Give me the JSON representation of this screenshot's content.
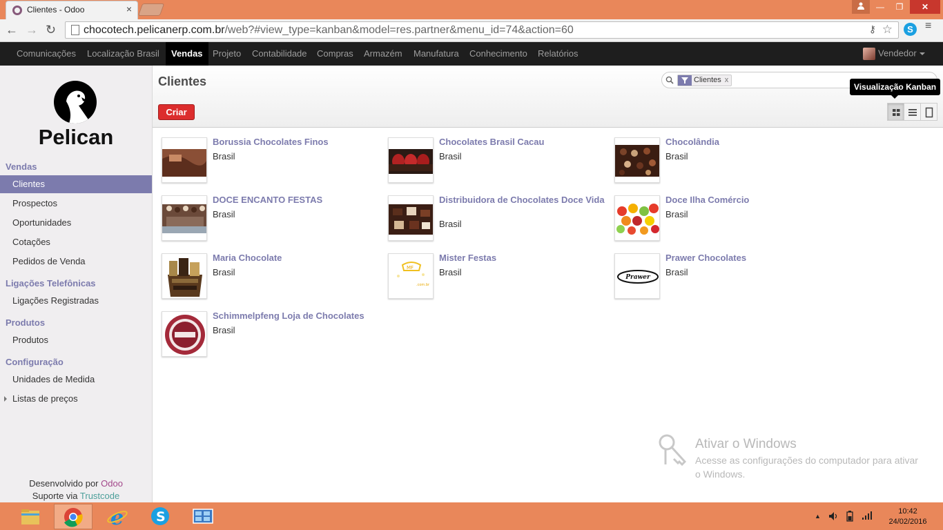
{
  "browser": {
    "tab_title": "Clientes - Odoo",
    "tab_close": "×",
    "url_host": "chocotech.pelicanerp.com.br",
    "url_path": "/web?#view_type=kanban&model=res.partner&menu_id=74&action=60",
    "back": "←",
    "forward": "→",
    "reload": "↻",
    "star": "☆",
    "key_icon": "⚷",
    "skype_letter": "S",
    "menu": "≡",
    "win_min": "—",
    "win_max": "❐",
    "win_close": "✕"
  },
  "topmenu": {
    "items": [
      {
        "label": "Comunicações"
      },
      {
        "label": "Localização Brasil"
      },
      {
        "label": "Vendas"
      },
      {
        "label": "Projeto"
      },
      {
        "label": "Contabilidade"
      },
      {
        "label": "Compras"
      },
      {
        "label": "Armazém"
      },
      {
        "label": "Manufatura"
      },
      {
        "label": "Conhecimento"
      },
      {
        "label": "Relatórios"
      }
    ],
    "active": "Vendas",
    "user": "Vendedor"
  },
  "sidebar": {
    "logo_text": "Pelican",
    "sections": [
      {
        "title": "Vendas",
        "items": [
          "Clientes",
          "Prospectos",
          "Oportunidades",
          "Cotações",
          "Pedidos de Venda"
        ]
      },
      {
        "title": "Ligações Telefônicas",
        "items": [
          "Ligações Registradas"
        ]
      },
      {
        "title": "Produtos",
        "items": [
          "Produtos"
        ]
      },
      {
        "title": "Configuração",
        "items": [
          "Unidades de Medida",
          "Listas de preços"
        ]
      }
    ],
    "active_item": "Clientes",
    "footer": {
      "dev_prefix": "Desenvolvido por ",
      "dev_brand": "Odoo",
      "support_prefix": "Suporte via ",
      "support_brand": "Trustcode"
    }
  },
  "controlpanel": {
    "title": "Clientes",
    "create_button": "Criar",
    "search_facet": "Clientes",
    "facet_remove": "x",
    "tooltip": "Visualização Kanban",
    "views": [
      "kanban",
      "list",
      "form"
    ]
  },
  "kanban": {
    "cards": [
      {
        "name": "Borussia Chocolates Finos",
        "country": "Brasil"
      },
      {
        "name": "Chocolates Brasil Cacau",
        "country": "Brasil"
      },
      {
        "name": "Chocolândia",
        "country": "Brasil"
      },
      {
        "name": "DOCE ENCANTO FESTAS",
        "country": "Brasil"
      },
      {
        "name": "Distribuidora de Chocolates Doce Vida",
        "country": "Brasil"
      },
      {
        "name": "Doce Ilha Comércio",
        "country": "Brasil"
      },
      {
        "name": "Maria Chocolate",
        "country": "Brasil"
      },
      {
        "name": "Mister Festas",
        "country": "Brasil"
      },
      {
        "name": "Prawer Chocolates",
        "country": "Brasil"
      },
      {
        "name": "Schimmelpfeng Loja de Chocolates",
        "country": "Brasil"
      }
    ]
  },
  "watermark": {
    "title": "Ativar o Windows",
    "subtitle": "Acesse as configurações do computador para ativar o Windows."
  },
  "taskbar": {
    "time": "10:42",
    "date": "24/02/2016",
    "tray_up": "▲"
  },
  "colors": {
    "accent": "#7c7bad",
    "create_button": "#dc2d2d",
    "titlebar": "#e9875a",
    "topmenu": "#1e1e1e"
  }
}
